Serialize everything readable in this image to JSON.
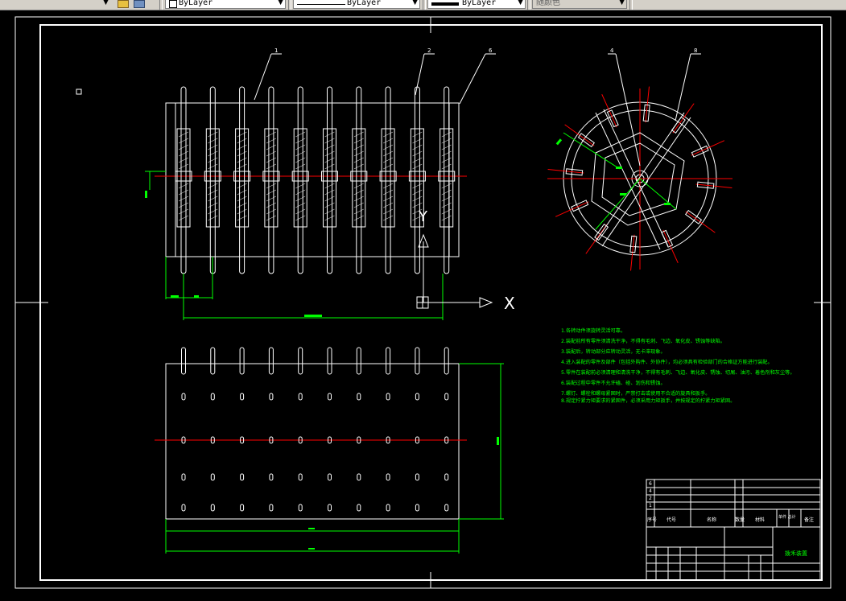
{
  "toolbar": {
    "layer_control": "ByLayer",
    "linetype_control": "ByLayer",
    "lineweight_control": "ByLayer",
    "plotstyle_control": "随颜色"
  },
  "drawing": {
    "balloons": [
      "1",
      "2",
      "6",
      "4",
      "8"
    ],
    "axis_y_label": "Y",
    "axis_x_label": "X",
    "technical_notes": [
      "1.各转动件须旋转灵活可靠。",
      "2.装配前所有零件须清洗干净，不得有毛刺、飞边、氧化皮、锈蚀等缺陷。",
      "3.装配后，转动部分应转动灵活，无卡滞现象。",
      "4.进入装配的零件及部件（包括外购件、外协件），均必须具有检验部门的合格证方能进行装配。",
      "5.零件在装配前必须清理和清洗干净，不得有毛刺、飞边、氧化皮、锈蚀、切屑、油污、着色剂和灰尘等。",
      "6.装配过程中零件不允许磕、碰、划伤和锈蚀。",
      "7.螺钉、螺栓和螺母紧固时，严禁打击或使用不合适的旋具和扳手。",
      "8.规定拧紧力矩要求的紧固件，必须采用力矩扳手，并按规定的拧紧力矩紧固。"
    ],
    "title_block": {
      "col_seq": "序号",
      "col_code": "代号",
      "col_name": "名称",
      "col_qty": "数量",
      "col_material": "材料",
      "col_weight": "单件 总计",
      "col_remark": "备注",
      "drawing_title": "拨禾装置",
      "rows": [
        "6",
        "4",
        "2",
        "1"
      ]
    }
  }
}
